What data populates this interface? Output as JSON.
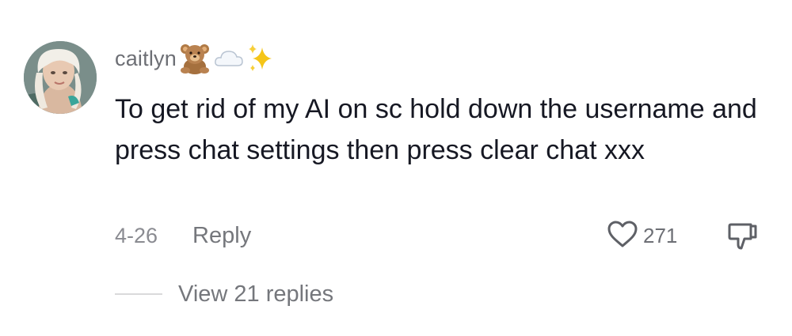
{
  "comment": {
    "username": "caitlyn",
    "username_emojis": [
      "teddy-bear",
      "cloud",
      "sparkles"
    ],
    "text": "To get rid of my AI on sc hold down the username and press chat settings then press clear chat xxx",
    "date": "4-26",
    "reply_label": "Reply",
    "like_count": "271",
    "view_replies_label": "View 21 replies"
  },
  "colors": {
    "text_primary": "#161823",
    "text_secondary": "#75777c",
    "divider": "#d9d9db"
  }
}
